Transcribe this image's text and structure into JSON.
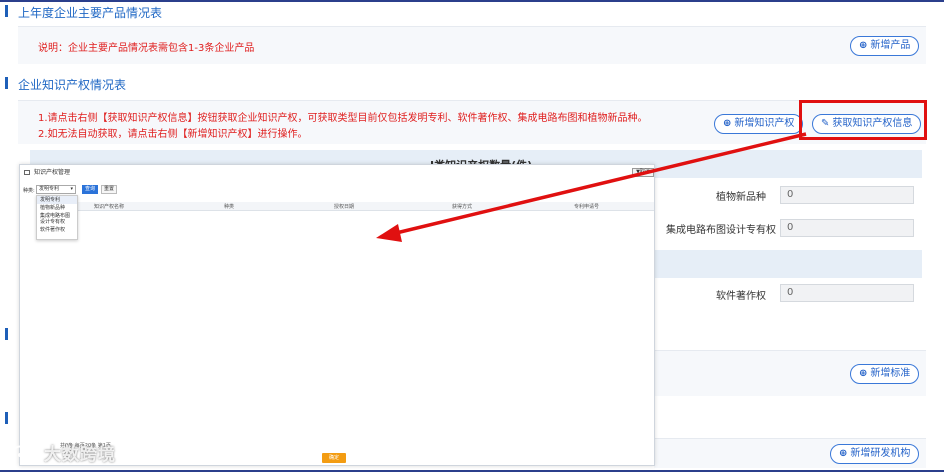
{
  "section1": {
    "title": "上年度企业主要产品情况表",
    "note": "说明：企业主要产品情况表需包含1-3条企业产品",
    "add_product_btn": "新增产品"
  },
  "section2": {
    "title": "企业知识产权情况表",
    "note_line1": "1.请点击右侧【获取知识产权信息】按钮获取企业知识产权，可获取类型目前仅包括发明专利、软件著作权、集成电路布图和植物新品种。",
    "note_line2": "2.如无法自动获取，请点击右侧【新增知识产权】进行操作。",
    "add_ip_btn": "新增知识产权",
    "fetch_ip_btn": "获取知识产权信息",
    "stats_header": "I类知识产权数量(件)",
    "rows": [
      {
        "label": "植物新品种",
        "value": "0"
      },
      {
        "label": "集成电路布图设计专有权",
        "value": "0"
      },
      {
        "label": "软件著作权",
        "value": "0"
      }
    ]
  },
  "section3": {
    "add_standard_btn": "新增标准"
  },
  "section4": {
    "add_org_btn": "新增研发机构"
  },
  "dialog": {
    "title": "知识产权管理",
    "close_label": "取消",
    "filter_label": "种类:",
    "select_value": "发明专利",
    "query_btn": "查询",
    "reset_btn": "重置",
    "options": [
      "发明专利",
      "植物新品种",
      "集成电路布图设计专有权",
      "软件著作权"
    ],
    "columns": [
      "知识产权名称",
      "种类",
      "授权日期",
      "获得方式",
      "专利申请号"
    ],
    "footer": "共0条 每页20条 第1页",
    "ok_btn": "确定"
  },
  "watermark": "大数跨境",
  "colors": {
    "accent": "#1f67c4",
    "alert": "#e02020",
    "highlight": "#e01010",
    "ok": "#f39c12"
  }
}
